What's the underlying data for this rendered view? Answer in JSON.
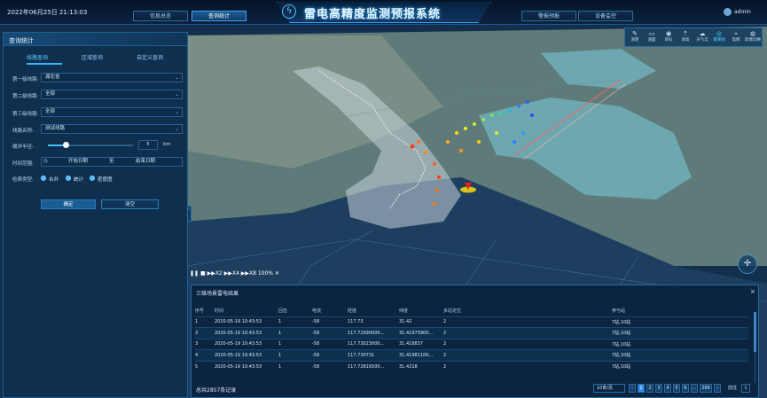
{
  "header": {
    "datetime": "2022年06月25日 21:13:03",
    "title": "雷电高精度监测预报系统",
    "nav": [
      "信息总览",
      "查询统计",
      "警报预报",
      "设备监控"
    ],
    "active_nav": "查询统计",
    "username": "admin"
  },
  "query_panel": {
    "title": "查询统计",
    "tabs": [
      "线路查询",
      "区域查询",
      "自定义查询"
    ],
    "active_tab": "线路查询",
    "fields": [
      {
        "label": "第一级线路:",
        "value": "湖北省"
      },
      {
        "label": "第二级线路:",
        "value": "全部"
      },
      {
        "label": "第三级线路:",
        "value": "全部"
      },
      {
        "label": "线路名称:",
        "value": "测试线路"
      }
    ],
    "radius_label": "缓冲半径:",
    "radius_value": "5",
    "radius_unit": "km",
    "radius_fraction": 0.2,
    "time_label": "时间范围:",
    "start_placeholder": "开始日期",
    "time_separator": "至",
    "end_placeholder": "结束日期",
    "type_label": "检索类型:",
    "types": [
      "合并",
      "统计",
      "密度图"
    ],
    "selected_type": "合并",
    "confirm_button": "确定",
    "clear_button": "清空"
  },
  "toolbar": {
    "items": [
      {
        "label": "测距",
        "icon": "ruler-icon"
      },
      {
        "label": "测面",
        "icon": "area-icon"
      },
      {
        "label": "目标",
        "icon": "target-icon"
      },
      {
        "label": "测高",
        "icon": "height-icon"
      },
      {
        "label": "天气云",
        "icon": "cloud-icon"
      },
      {
        "label": "雷暴图",
        "icon": "storm-icon"
      },
      {
        "label": "电网",
        "icon": "grid-icon"
      },
      {
        "label": "影像切换",
        "icon": "globe-icon"
      }
    ],
    "active": "雷暴图"
  },
  "playback": {
    "speeds": [
      "X2",
      "X4",
      "X8"
    ],
    "progress_text": "100%"
  },
  "results": {
    "title": "三维场景雷电结果",
    "columns": [
      "序号",
      "时间",
      "回击",
      "电流",
      "经度",
      "纬度",
      "多站定位",
      "参与站"
    ],
    "rows": [
      [
        "1",
        "2020-05-19 10:43:53",
        "1",
        "-58",
        "117.73",
        "31.42",
        "2",
        "7站,10站"
      ],
      [
        "2",
        "2020-05-19 10:43:53",
        "1",
        "-58",
        "117.72990000...",
        "31.41973900...",
        "2",
        "7站,10站"
      ],
      [
        "3",
        "2020-05-19 10:43:53",
        "1",
        "-58",
        "117.73023000...",
        "31.418837",
        "2",
        "7站,10站"
      ],
      [
        "4",
        "2020-05-19 10:43:53",
        "1",
        "-58",
        "117.730731",
        "31.41981100...",
        "2",
        "7站,10站"
      ],
      [
        "5",
        "2020-05-19 10:43:53",
        "1",
        "-58",
        "117.72816500...",
        "31.4218",
        "2",
        "7站,10站"
      ]
    ],
    "total_text": "总共2857条记录",
    "per_page": "10条/页",
    "pages": [
      "1",
      "2",
      "3",
      "4",
      "5",
      "6",
      "...",
      "286"
    ],
    "current_page": "1",
    "prev": "‹",
    "next": "›",
    "goto_label": "前往",
    "goto_value": "1",
    "close": "×"
  },
  "colors": {
    "accent": "#35b6ff",
    "panel": "#0e304e",
    "land": "#5b7a7e",
    "water": "#6aa7ae"
  }
}
